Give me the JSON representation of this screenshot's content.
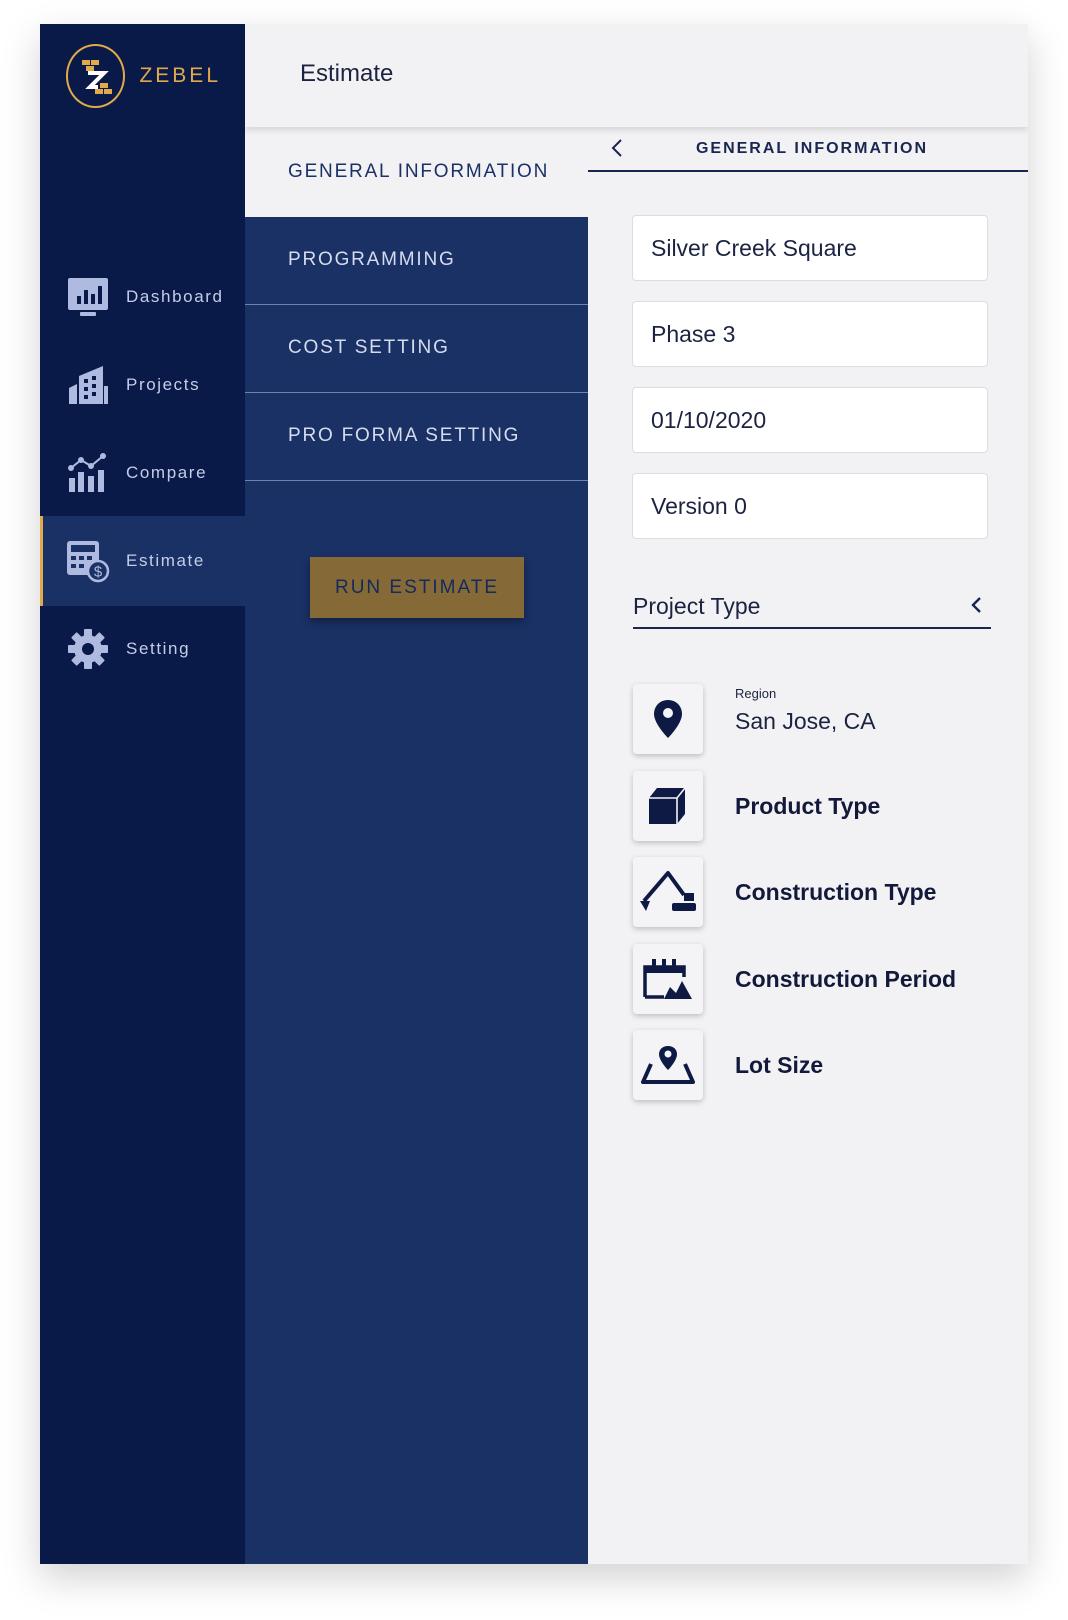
{
  "brand": {
    "name": "ZEBEL",
    "accent_color": "#e0aa4a"
  },
  "sidebar": {
    "items": [
      {
        "label": "Dashboard",
        "icon": "dashboard-icon"
      },
      {
        "label": "Projects",
        "icon": "building-icon"
      },
      {
        "label": "Compare",
        "icon": "compare-chart-icon"
      },
      {
        "label": "Estimate",
        "icon": "calculator-dollar-icon",
        "active": true
      },
      {
        "label": "Setting",
        "icon": "gear-icon"
      }
    ]
  },
  "header": {
    "title": "Estimate"
  },
  "menu": {
    "items": [
      {
        "label": "GENERAL INFORMATION",
        "active": true
      },
      {
        "label": "PROGRAMMING"
      },
      {
        "label": "COST SETTING"
      },
      {
        "label": "PRO FORMA SETTING"
      }
    ],
    "run_label": "RUN ESTIMATE"
  },
  "panel": {
    "title": "GENERAL INFORMATION",
    "fields": {
      "project_name": "Silver Creek Square",
      "phase": "Phase 3",
      "date": "01/10/2020",
      "version": "Version 0"
    },
    "project_type_label": "Project Type",
    "attributes": {
      "region": {
        "label": "Region",
        "value": "San Jose, CA",
        "icon": "location-pin-icon"
      },
      "product_type": {
        "label": "Product Type",
        "icon": "cube-icon"
      },
      "construction_type": {
        "label": "Construction Type",
        "icon": "excavator-icon"
      },
      "construction_period": {
        "label": "Construction Period",
        "icon": "construction-calendar-icon"
      },
      "lot_size": {
        "label": "Lot Size",
        "icon": "map-pin-area-icon"
      }
    }
  }
}
